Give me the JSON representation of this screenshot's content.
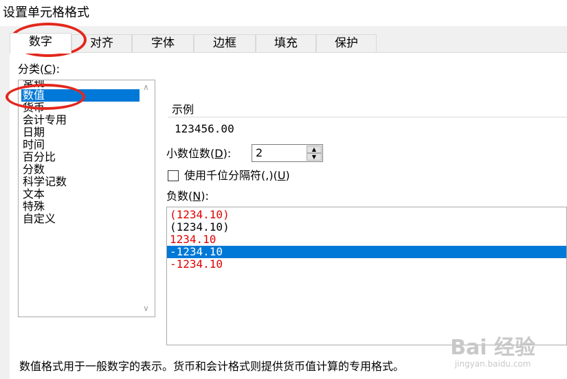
{
  "window": {
    "title": "设置单元格格式"
  },
  "tabs": [
    {
      "label": "数字",
      "active": true
    },
    {
      "label": "对齐",
      "active": false
    },
    {
      "label": "字体",
      "active": false
    },
    {
      "label": "边框",
      "active": false
    },
    {
      "label": "填充",
      "active": false
    },
    {
      "label": "保护",
      "active": false
    }
  ],
  "category": {
    "label_main": "分类(",
    "label_key": "C",
    "label_end": "):",
    "items": [
      "常规",
      "数值",
      "货币",
      "会计专用",
      "日期",
      "时间",
      "百分比",
      "分数",
      "科学记数",
      "文本",
      "特殊",
      "自定义"
    ],
    "selected": "数值"
  },
  "sample": {
    "label": "示例",
    "value": "123456.00"
  },
  "decimals": {
    "label_main": "小数位数(",
    "label_key": "D",
    "label_end": "):",
    "value": "2"
  },
  "thousands": {
    "label_main": "使用千位分隔符(,)(",
    "label_key": "U",
    "label_end": ")",
    "checked": false
  },
  "negative": {
    "label_main": "负数(",
    "label_key": "N",
    "label_end": "):",
    "items": [
      {
        "text": "(1234.10)",
        "color": "#e00000"
      },
      {
        "text": "(1234.10)",
        "color": "#000000"
      },
      {
        "text": "1234.10",
        "color": "#e00000"
      },
      {
        "text": "-1234.10",
        "color": "#000000",
        "selected": true
      },
      {
        "text": "-1234.10",
        "color": "#e00000"
      }
    ]
  },
  "description": "数值格式用于一般数字的表示。货币和会计格式则提供货币值计算的专用格式。",
  "watermark": {
    "main": "Bai 经验",
    "sub": "jingyan.baidu.com"
  },
  "colors": {
    "selection": "#0078d7",
    "negative_red": "#e00000",
    "annotation": "#e3271d"
  }
}
